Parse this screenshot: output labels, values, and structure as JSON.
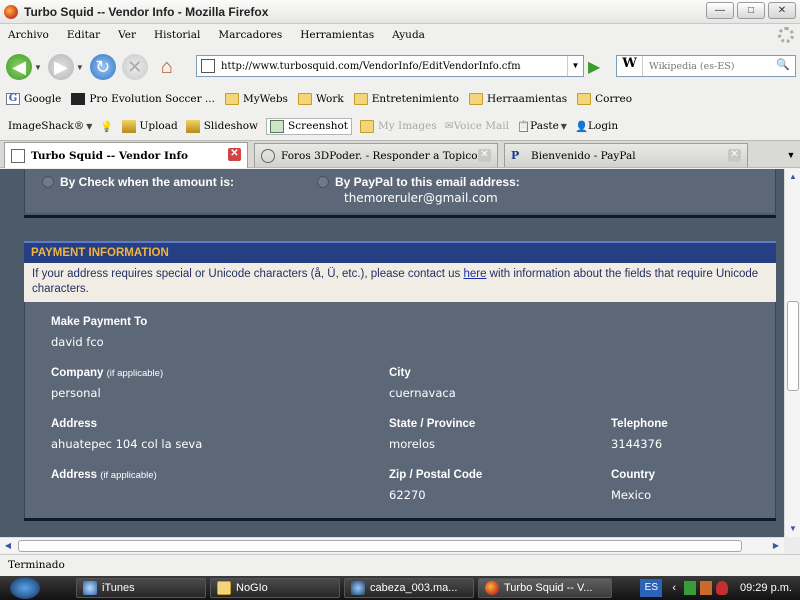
{
  "window": {
    "title": "Turbo Squid -- Vendor Info - Mozilla Firefox",
    "buttons": {
      "minimize": "—",
      "maximize": "□",
      "close": "✕"
    }
  },
  "menu": [
    "Archivo",
    "Editar",
    "Ver",
    "Historial",
    "Marcadores",
    "Herramientas",
    "Ayuda"
  ],
  "nav": {
    "url": "http://www.turbosquid.com/VendorInfo/EditVendorInfo.cfm",
    "search_engine": "W",
    "search_placeholder": "Wikipedia (es-ES)"
  },
  "bookmarks": [
    "Google",
    "Pro Evolution Soccer ...",
    "MyWebs",
    "Work",
    "Entretenimiento",
    "Herraamientas",
    "Correo"
  ],
  "toolbar2": {
    "imageshack": "ImageShack®",
    "upload": "Upload",
    "slideshow": "Slideshow",
    "screenshot": "Screenshot",
    "myimages": "My Images",
    "voicemail": "Voice Mail",
    "paste": "Paste",
    "login": "Login"
  },
  "tabs": [
    {
      "label": "Turbo Squid -- Vendor Info",
      "active": true
    },
    {
      "label": "Foros 3DPoder. - Responder a Topico",
      "active": false
    },
    {
      "label": "Bienvenido - PayPal",
      "active": false
    }
  ],
  "page": {
    "pay_by_check": "By Check when the amount is:",
    "pay_by_paypal": "By PayPal to this email address:",
    "paypal_email": "themoreruler@gmail.com",
    "payment_header": "PAYMENT INFORMATION",
    "notice_pre": "If your address requires special or Unicode characters (å, Ü, etc.), please contact us ",
    "notice_link": "here",
    "notice_post": " with information about the fields that require Unicode characters.",
    "fields": {
      "make_payment_to_label": "Make Payment To",
      "make_payment_to_value": "david fco",
      "company_label": "Company",
      "company_hint": "(if applicable)",
      "company_value": "personal",
      "city_label": "City",
      "city_value": "cuernavaca",
      "address_label": "Address",
      "address_value": "ahuatepec 104 col la seva",
      "state_label": "State / Province",
      "state_value": "morelos",
      "telephone_label": "Telephone",
      "telephone_value": "3144376",
      "address2_label": "Address",
      "address2_hint": "(if applicable)",
      "zip_label": "Zip / Postal Code",
      "zip_value": "62270",
      "country_label": "Country",
      "country_value": "Mexico"
    }
  },
  "status": "Terminado",
  "taskbar": {
    "items": [
      "iTunes",
      "NoGIo",
      "cabeza_003.ma...",
      "Turbo Squid -- V..."
    ],
    "lang": "ES",
    "clock": "09:29 p.m."
  },
  "colors": {
    "page_bg": "#4d5a6a",
    "panel_bg": "#5c6778",
    "header_bg": "#263f82",
    "header_text": "#f0b441",
    "notice_bg": "#f1ede5"
  }
}
